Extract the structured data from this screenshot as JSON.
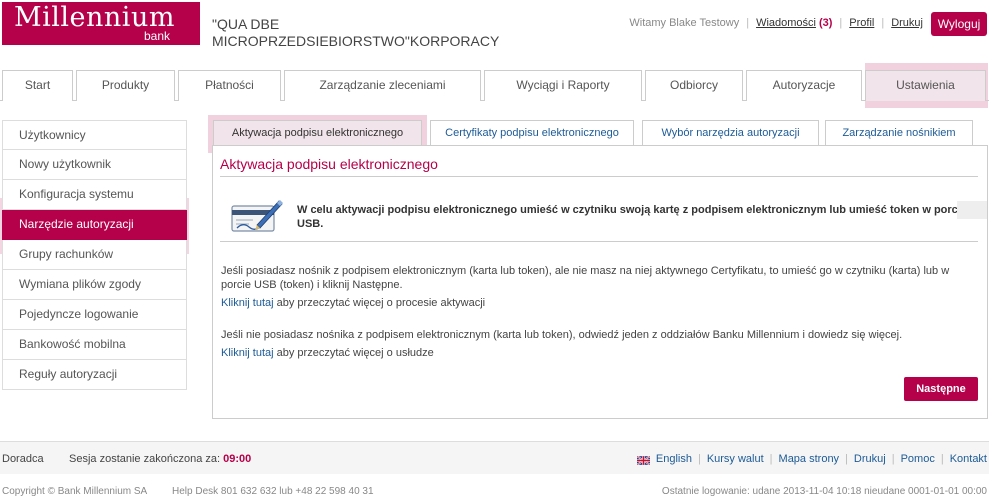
{
  "header": {
    "logo_main": "Millennium",
    "logo_sub": "bank",
    "company_name": "\"QUA DBE MICROPRZEDSIEBIORSTWO\"KORPORACY",
    "welcome": "Witamy Blake Testowy",
    "messages_label": "Wiadomości",
    "messages_count": "(3)",
    "profile_label": "Profil",
    "print_label": "Drukuj",
    "logout_label": "Wyloguj"
  },
  "main_tabs": [
    {
      "label": "Start"
    },
    {
      "label": "Produkty"
    },
    {
      "label": "Płatności"
    },
    {
      "label": "Zarządzanie zleceniami"
    },
    {
      "label": "Wyciągi i Raporty"
    },
    {
      "label": "Odbiorcy"
    },
    {
      "label": "Autoryzacje"
    },
    {
      "label": "Ustawienia",
      "active": true
    }
  ],
  "sidebar": {
    "items": [
      {
        "label": "Użytkownicy"
      },
      {
        "label": "Nowy użytkownik"
      },
      {
        "label": "Konfiguracja systemu"
      },
      {
        "label": "Narzędzie autoryzacji",
        "active": true
      },
      {
        "label": "Grupy rachunków"
      },
      {
        "label": "Wymiana plików zgody"
      },
      {
        "label": "Pojedyncze logowanie"
      },
      {
        "label": "Bankowość mobilna"
      },
      {
        "label": "Reguły autoryzacji"
      }
    ]
  },
  "sub_tabs": [
    {
      "label": "Aktywacja podpisu elektronicznego",
      "active": true
    },
    {
      "label": "Certyfikaty podpisu elektronicznego"
    },
    {
      "label": "Wybór narzędzia autoryzacji"
    },
    {
      "label": "Zarządzanie nośnikiem"
    }
  ],
  "content": {
    "title": "Aktywacja podpisu elektronicznego",
    "info": "W celu aktywacji podpisu elektronicznego umieść w czytniku swoją kartę z podpisem elektronicznym lub umieść token w porcie USB.",
    "para1": "Jeśli posiadasz nośnik z podpisem elektronicznym (karta lub token), ale nie masz na niej aktywnego Certyfikatu, to umieść go w czytniku (karta) lub w porcie USB (token) i kliknij Następne.",
    "link1": "Kliknij tutaj",
    "link1_rest": " aby przeczytać więcej o procesie aktywacji",
    "para2": "Jeśli nie posiadasz nośnika z podpisem elektronicznym (karta lub token), odwiedź jeden z oddziałów Banku Millennium i dowiedz się więcej.",
    "link2": "Kliknij tutaj",
    "link2_rest": " aby przeczytać więcej o usłudze",
    "next_label": "Następne"
  },
  "footer": {
    "advisor": "Doradca",
    "session_label": "Sesja zostanie zakończona za:",
    "session_time": "09:00",
    "links": [
      "English",
      "Kursy walut",
      "Mapa strony",
      "Drukuj",
      "Pomoc",
      "Kontakt"
    ],
    "copyright": "Copyright © Bank Millennium SA",
    "helpdesk": "Help Desk 801 632 632 lub +48 22 598 40 31",
    "last_login": "Ostatnie logowanie: udane 2013-11-04 10:18     nieudane 0001-01-01 00:00"
  },
  "colors": {
    "brand": "#b5004a",
    "link": "#1d5b96",
    "active_tab_bg": "#f1e4ea"
  },
  "icons": [
    "signature-card-icon",
    "uk-flag-icon"
  ]
}
